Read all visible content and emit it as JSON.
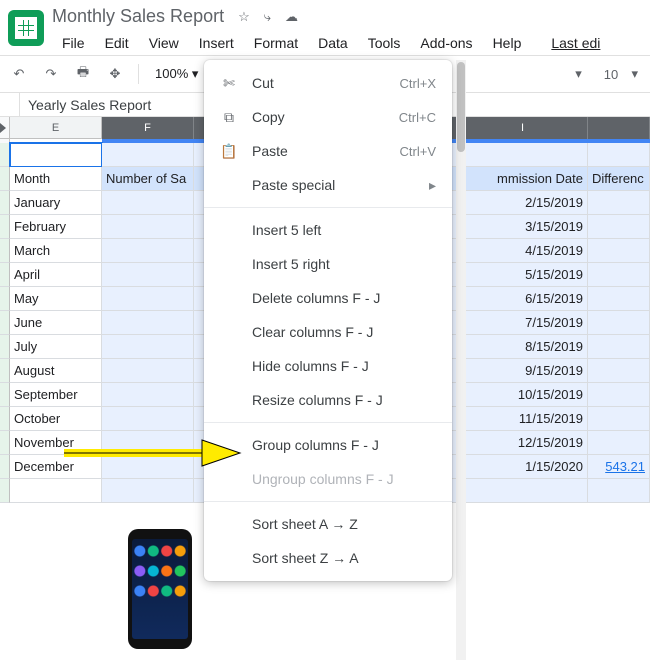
{
  "doc": {
    "title": "Monthly Sales Report"
  },
  "menubar": [
    "File",
    "Edit",
    "View",
    "Insert",
    "Format",
    "Data",
    "Tools",
    "Add-ons",
    "Help"
  ],
  "last_edit": "Last edi",
  "toolbar": {
    "zoom": "100%",
    "fontsize": "10"
  },
  "formula_bar": {
    "cell_ref": "Yearly Sales Report"
  },
  "columns": {
    "E": "E",
    "F": "F",
    "I": "I",
    "widths": {
      "E": 92,
      "F": 92,
      "gap": 264,
      "I": 130,
      "J": 62
    }
  },
  "headers": {
    "month": "Month",
    "numsales": "Number of Sa",
    "commdate": "mmission Date",
    "diff": "Differenc"
  },
  "rows": [
    {
      "month": "January",
      "date": "2/15/2019"
    },
    {
      "month": "February",
      "date": "3/15/2019"
    },
    {
      "month": "March",
      "date": "4/15/2019"
    },
    {
      "month": "April",
      "date": "5/15/2019"
    },
    {
      "month": "May",
      "date": "6/15/2019"
    },
    {
      "month": "June",
      "date": "7/15/2019"
    },
    {
      "month": "July",
      "date": "8/15/2019"
    },
    {
      "month": "August",
      "date": "9/15/2019"
    },
    {
      "month": "September",
      "date": "10/15/2019"
    },
    {
      "month": "October",
      "date": "11/15/2019"
    },
    {
      "month": "November",
      "date": "12/15/2019"
    },
    {
      "month": "December",
      "date": "1/15/2020",
      "diff": "543.21"
    }
  ],
  "context_menu": {
    "cut": "Cut",
    "cut_sc": "Ctrl+X",
    "copy": "Copy",
    "copy_sc": "Ctrl+C",
    "paste": "Paste",
    "paste_sc": "Ctrl+V",
    "paste_special": "Paste special",
    "insert_left": "Insert 5 left",
    "insert_right": "Insert 5 right",
    "delete_cols": "Delete columns F - J",
    "clear_cols": "Clear columns F - J",
    "hide_cols": "Hide columns F - J",
    "resize_cols": "Resize columns F - J",
    "group_cols": "Group columns F - J",
    "ungroup_cols": "Ungroup columns F - J",
    "sort_az": "Sort sheet A → Z",
    "sort_za": "Sort sheet Z → A"
  }
}
